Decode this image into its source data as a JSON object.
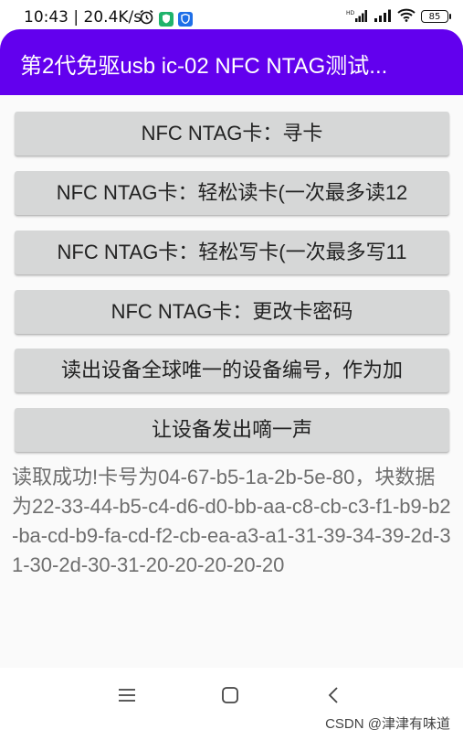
{
  "status_bar": {
    "time": "10:43",
    "speed": "20.4K/s",
    "battery": "85",
    "signal_label": "HD"
  },
  "app_bar": {
    "title": "第2代免驱usb ic-02 NFC NTAG测试..."
  },
  "buttons": [
    {
      "label": "NFC NTAG卡：寻卡"
    },
    {
      "label": "NFC NTAG卡：轻松读卡(一次最多读12"
    },
    {
      "label": "NFC NTAG卡：轻松写卡(一次最多写11"
    },
    {
      "label": "NFC NTAG卡：更改卡密码"
    },
    {
      "label": "读出设备全球唯一的设备编号，作为加"
    },
    {
      "label": "让设备发出嘀一声"
    }
  ],
  "result": {
    "text": "读取成功!卡号为04-67-b5-1a-2b-5e-80，块数据为22-33-44-b5-c4-d6-d0-bb-aa-c8-cb-c3-f1-b9-b2-ba-cd-b9-fa-cd-f2-cb-ea-a3-a1-31-39-34-39-2d-31-30-2d-30-31-20-20-20-20-20"
  },
  "watermark": "CSDN @津津有味道",
  "colors": {
    "primary": "#6200ee",
    "button_bg": "#d6d7d7",
    "result_text": "#6e6e6e"
  }
}
